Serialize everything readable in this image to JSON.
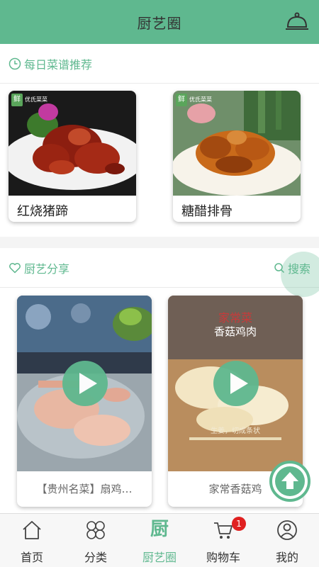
{
  "header": {
    "title": "厨艺圈",
    "right_icon": "cloche-icon"
  },
  "daily": {
    "title": "每日菜谱推荐",
    "icon": "clock-icon",
    "cards": [
      {
        "label": "红烧猪蹄",
        "logo": "鲜",
        "logo_text": "优氏菜菜"
      },
      {
        "label": "糖醋排骨",
        "logo": "鲜",
        "logo_text": "优氏菜菜"
      }
    ]
  },
  "share": {
    "title": "厨艺分享",
    "icon": "heart-icon",
    "search_label": "搜索",
    "videos": [
      {
        "label": "【贵州名菜】扇鸡…"
      },
      {
        "label": "家常香菇鸡",
        "overlay_title": "家常菜",
        "overlay_subtitle": "香菇鸡肉",
        "overlay_note": "生姜，切成条状"
      }
    ]
  },
  "tabbar": {
    "items": [
      {
        "label": "首页",
        "icon": "home-icon"
      },
      {
        "label": "分类",
        "icon": "category-icon"
      },
      {
        "label": "厨艺圈",
        "icon": "kitchen-icon",
        "glyph": "厨"
      },
      {
        "label": "购物车",
        "icon": "cart-icon",
        "badge": "1"
      },
      {
        "label": "我的",
        "icon": "user-icon"
      }
    ],
    "active_index": 2
  },
  "colors": {
    "accent": "#5fb88f",
    "badge": "#e02020"
  }
}
